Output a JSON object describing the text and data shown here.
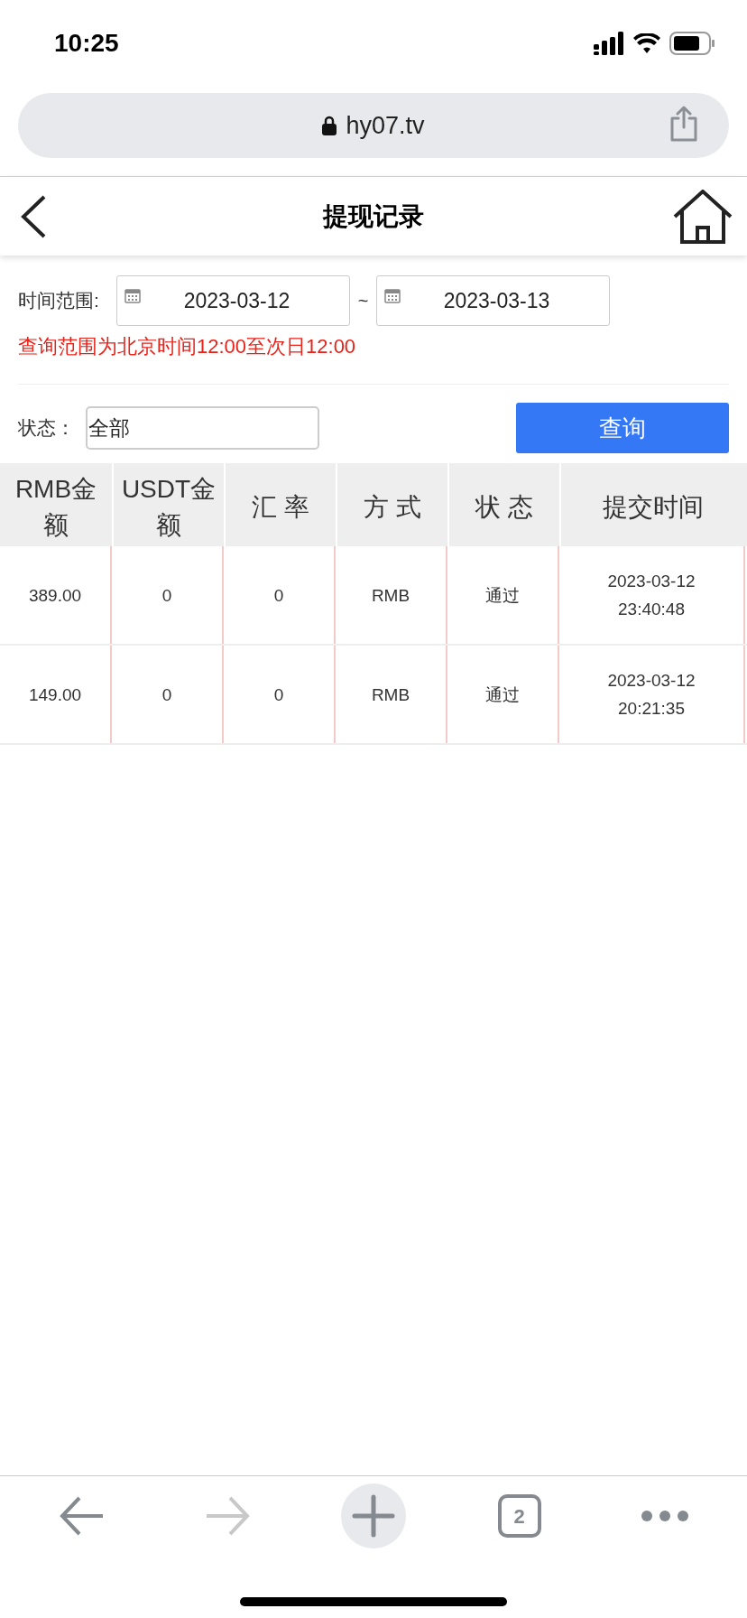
{
  "status_bar": {
    "time": "10:25"
  },
  "browser": {
    "url": "hy07.tv"
  },
  "header": {
    "title": "提现记录"
  },
  "filter": {
    "range_label": "时间范围:",
    "start_date": "2023-03-12",
    "separator": "~",
    "end_date": "2023-03-13",
    "note": "查询范围为北京时间12:00至次日12:00",
    "status_label": "状态：",
    "status_value": "全部",
    "query_button": "查询"
  },
  "table": {
    "columns": [
      "RMB金额",
      "USDT金额",
      "汇 率",
      "方 式",
      "状 态",
      "提交时间"
    ],
    "rows": [
      [
        "389.00",
        "0",
        "0",
        "RMB",
        "通过",
        "2023-03-12\n23:40:48"
      ],
      [
        "149.00",
        "0",
        "0",
        "RMB",
        "通过",
        "2023-03-12\n20:21:35"
      ]
    ]
  },
  "toolbar": [
    {
      "kind": "back",
      "disabled": false
    },
    {
      "kind": "forward",
      "disabled": true
    },
    {
      "kind": "new-tab",
      "disabled": false
    },
    {
      "kind": "tabs",
      "disabled": false,
      "count": "2"
    },
    {
      "kind": "more",
      "disabled": false
    }
  ]
}
